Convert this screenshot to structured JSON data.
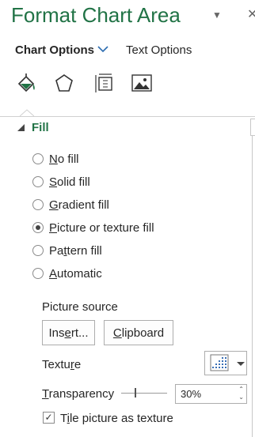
{
  "panel": {
    "title": "Format Chart Area",
    "pin_glyph": "▼",
    "close_glyph": "✕"
  },
  "tabs": {
    "chart_options": "Chart Options",
    "text_options": "Text Options"
  },
  "icons": [
    "fill-line-icon",
    "effects-pentagon-icon",
    "size-properties-icon",
    "picture-icon"
  ],
  "fill": {
    "header": "Fill",
    "options": [
      {
        "pre": "",
        "u": "N",
        "post": "o fill",
        "selected": false
      },
      {
        "pre": "",
        "u": "S",
        "post": "olid fill",
        "selected": false
      },
      {
        "pre": "",
        "u": "G",
        "post": "radient fill",
        "selected": false
      },
      {
        "pre": "",
        "u": "P",
        "post": "icture or texture fill",
        "selected": true
      },
      {
        "pre": "Pa",
        "u": "t",
        "post": "tern fill",
        "selected": false
      },
      {
        "pre": "",
        "u": "A",
        "post": "utomatic",
        "selected": false
      }
    ]
  },
  "picture_source": {
    "label": "Picture source",
    "insert_pre": "Ins",
    "insert_u": "e",
    "insert_post": "rt...",
    "clipboard_pre": "",
    "clipboard_u": "C",
    "clipboard_post": "lipboard"
  },
  "texture": {
    "pre": "Textu",
    "u": "r",
    "post": "e"
  },
  "transparency": {
    "pre": "",
    "u": "T",
    "post": "ransparency",
    "value": "30%",
    "level_percent": 30
  },
  "tile": {
    "pre": "T",
    "u": "i",
    "post": "le picture as texture",
    "checked": true,
    "check_glyph": "✓"
  },
  "colors": {
    "accent": "#217346",
    "text": "#262626",
    "border": "#adadad"
  }
}
